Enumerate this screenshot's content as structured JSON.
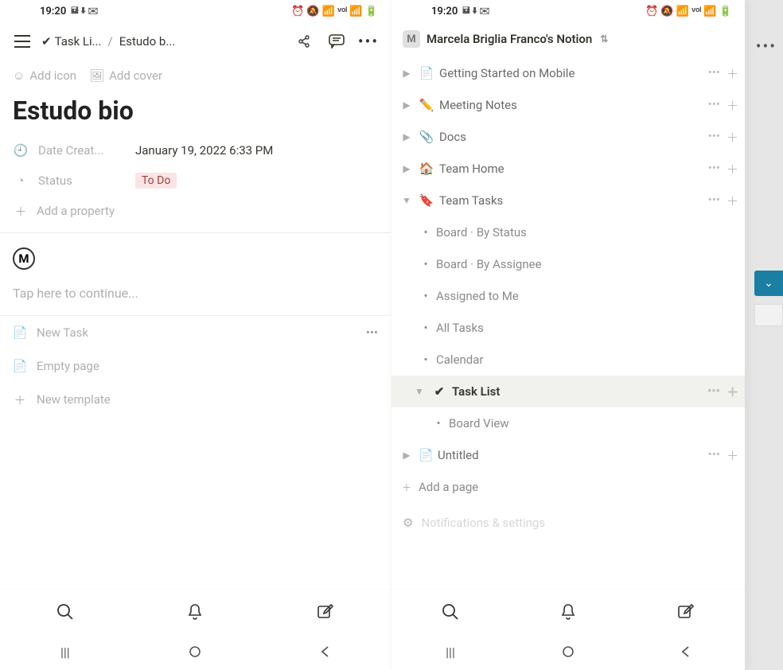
{
  "status": {
    "time": "19:20",
    "left_icons": "🖬 ⬇ ✉",
    "right_icons": "⏰ 🔕 📶 ᵛᵒˡ 📶 🔋"
  },
  "phone1": {
    "breadcrumb": {
      "check": "✔",
      "parent": "Task Li...",
      "current": "Estudo b..."
    },
    "add_icon": "Add icon",
    "add_cover": "Add cover",
    "title": "Estudo bio",
    "props": {
      "date_label": "Date Creat...",
      "date_value": "January 19, 2022 6:33 PM",
      "status_label": "Status",
      "status_value": "To Do",
      "add_property": "Add a property"
    },
    "m_letter": "M",
    "tap_continue": "Tap here to continue...",
    "templates": {
      "new_task": "New Task",
      "empty_page": "Empty page",
      "new_template": "New template"
    }
  },
  "phone2": {
    "workspace": "Marcela Briglia Franco's Notion",
    "items": {
      "getting_started": "Getting Started on Mobile",
      "meeting_notes": "Meeting Notes",
      "docs": "Docs",
      "team_home": "Team Home",
      "team_tasks": "Team Tasks",
      "board_by_status": "Board · By Status",
      "board_by_assignee": "Board · By Assignee",
      "assigned_to_me": "Assigned to Me",
      "all_tasks": "All Tasks",
      "calendar": "Calendar",
      "task_list": "Task List",
      "board_view": "Board View",
      "untitled": "Untitled",
      "add_page": "Add a page",
      "notifications": "Notifications & settings"
    }
  }
}
